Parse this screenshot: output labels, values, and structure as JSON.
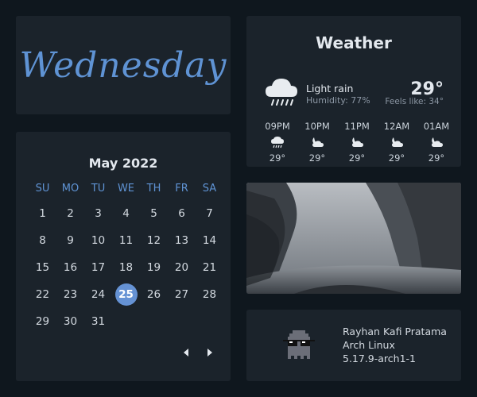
{
  "day": {
    "name": "Wednesday"
  },
  "calendar": {
    "title": "May 2022",
    "weekdays": [
      "SU",
      "MO",
      "TU",
      "WE",
      "TH",
      "FR",
      "SA"
    ],
    "days": [
      "1",
      "2",
      "3",
      "4",
      "5",
      "6",
      "7",
      "8",
      "9",
      "10",
      "11",
      "12",
      "13",
      "14",
      "15",
      "16",
      "17",
      "18",
      "19",
      "20",
      "21",
      "22",
      "23",
      "24",
      "25",
      "26",
      "27",
      "28",
      "29",
      "30",
      "31"
    ],
    "today": "25",
    "nav": {
      "prev_icon": "chevron-left-icon",
      "next_icon": "chevron-right-icon"
    }
  },
  "weather": {
    "title": "Weather",
    "condition": "Light rain",
    "humidity": "Humidity: 77%",
    "temperature": "29°",
    "feels_like": "Feels like: 34°",
    "icon": "rain-cloud-icon",
    "hourly": [
      {
        "time": "09PM",
        "temp": "29°",
        "icon": "rain-cloud-icon"
      },
      {
        "time": "10PM",
        "temp": "29°",
        "icon": "cloudy-night-icon"
      },
      {
        "time": "11PM",
        "temp": "29°",
        "icon": "cloudy-night-icon"
      },
      {
        "time": "12AM",
        "temp": "29°",
        "icon": "cloudy-night-icon"
      },
      {
        "time": "01AM",
        "temp": "29°",
        "icon": "cloudy-night-icon"
      }
    ]
  },
  "image": {
    "subject": "mountain-landscape"
  },
  "user": {
    "name": "Rayhan Kafi Pratama",
    "os": "Arch Linux",
    "kernel": "5.17.9-arch1-1",
    "avatar_icon": "pixel-ghost-icon"
  },
  "colors": {
    "background": "#0f171e",
    "card": "#1b232b",
    "accent": "#5f93d4",
    "today_highlight": "#6592d4",
    "text": "#d4dae1"
  }
}
